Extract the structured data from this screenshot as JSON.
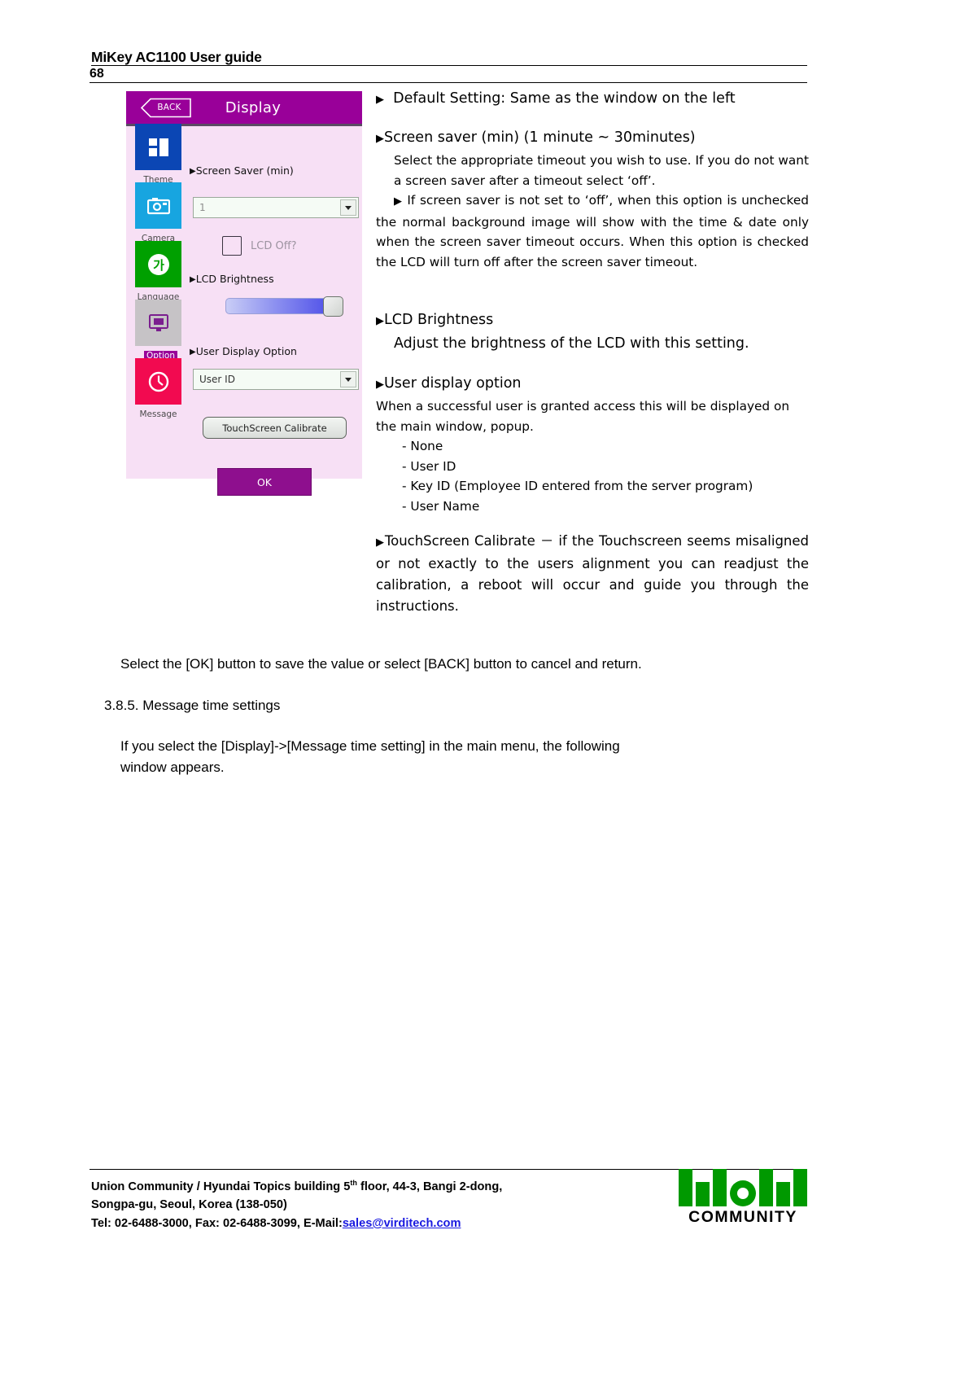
{
  "header": {
    "title": "MiKey AC1100 User guide",
    "page_number": "68"
  },
  "device": {
    "back_button": "BACK",
    "title": "Display",
    "rail": [
      {
        "label": "Theme",
        "icon": "theme-icon",
        "color": "#0b46b4",
        "selected": false
      },
      {
        "label": "Camera",
        "icon": "camera-icon",
        "color": "#17a5e0",
        "selected": false
      },
      {
        "label": "Language",
        "icon": "language-icon",
        "color": "#00a000",
        "selected": false
      },
      {
        "label": "Option",
        "icon": "option-icon",
        "color": "#c6c3c6",
        "selected": true
      },
      {
        "label": "Message",
        "icon": "clock-icon",
        "color": "#f20a50",
        "selected": false
      }
    ],
    "screen_saver_label": "Screen Saver (min)",
    "screen_saver_value": "1",
    "lcd_off_label": "LCD Off?",
    "lcd_off_checked": false,
    "lcd_brightness_label": "LCD Brightness",
    "lcd_brightness_percent": 88,
    "user_display_option_label": "User Display Option",
    "user_display_option_value": "User ID",
    "calibrate_button": "TouchScreen Calibrate",
    "ok_button": "OK"
  },
  "right_column": {
    "default_setting": "Default Setting: Same as the window on the left",
    "screen_saver_heading": "Screen saver (min) (1 minute ~ 30minutes)",
    "screen_saver_para1": "Select the appropriate timeout you wish to use. If you do not want a screen saver after a timeout select ‘off’.",
    "screen_saver_para2": "If screen saver is not set to ‘off’, when this option is unchecked the normal background image will show with the time & date only when the screen saver timeout occurs. When this option is checked the LCD will turn off after the screen saver timeout.",
    "lcd_brightness_heading": "LCD Brightness",
    "lcd_brightness_para": "Adjust the brightness of the LCD with this setting.",
    "user_display_heading": "User display option",
    "user_display_para": "When a successful user is granted access this will be displayed on the main window, popup.",
    "user_display_items": [
      "- None",
      "- User ID",
      "- Key ID (Employee ID entered from the server program)",
      "- User Name"
    ],
    "touchscreen_para": "TouchScreen Calibrate － if the Touchscreen seems misaligned or not exactly to the users alignment you can readjust the calibration, a reboot will occur and guide you through the instructions."
  },
  "lower": {
    "select_ok_text": "Select the [OK] button to save the value or select [BACK] button to cancel and return.",
    "section_heading": "3.8.5. Message time settings",
    "section_para_line1": "If you select the [Display]->[Message time setting] in the main menu, the following",
    "section_para_line2": "window appears."
  },
  "footer": {
    "line1_a": "Union Community / Hyundai Topics building 5",
    "line1_sup": "th",
    "line1_b": " floor, 44-3, Bangi 2-dong,",
    "line2": "Songpa-gu, Seoul, Korea (138-050)",
    "line3_a": "Tel: 02-6488-3000, Fax: 02-6488-3099, E-Mail:",
    "line3_link": "sales@virditech.com",
    "logo_word": "COMMUNITY"
  },
  "colors": {
    "device_titlebar": "#990099",
    "device_bg": "#f7e0f5",
    "ok_button": "#8e0f8e",
    "link": "#1a1ae0",
    "logo_green": "#009900"
  }
}
